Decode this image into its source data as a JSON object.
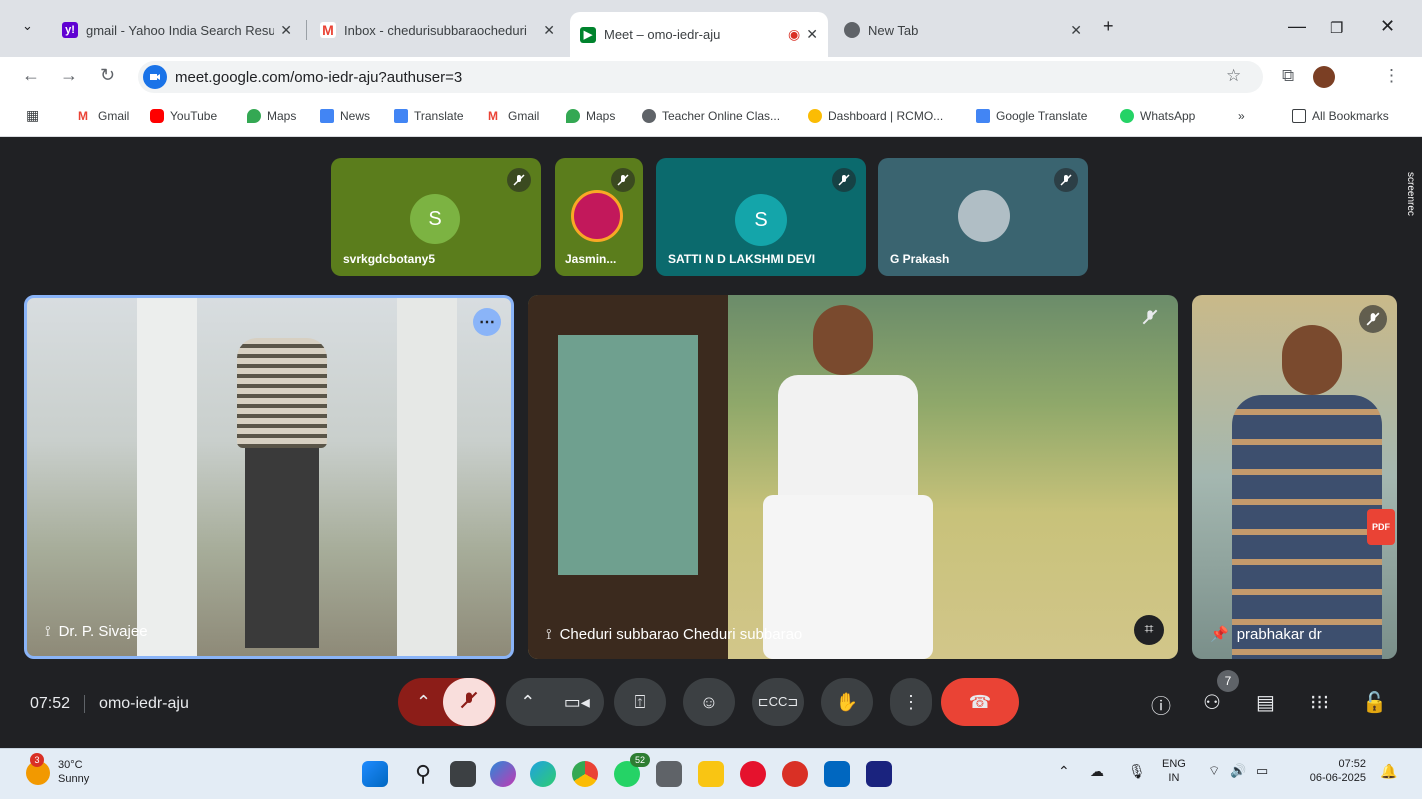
{
  "browser": {
    "tabs": [
      {
        "label": "gmail - Yahoo India Search Resu",
        "icon": "yahoo-icon"
      },
      {
        "label": "Inbox - chedurisubbaraocheduri",
        "icon": "gmail-icon"
      },
      {
        "label": "Meet – omo-iedr-aju",
        "icon": "meet-icon"
      },
      {
        "label": "New Tab",
        "icon": "chrome-icon"
      }
    ],
    "url": "meet.google.com/omo-iedr-aju?authuser=3",
    "bookmarks": [
      "Gmail",
      "YouTube",
      "Maps",
      "News",
      "Translate",
      "Gmail",
      "Maps",
      "Teacher Online Clas...",
      "Dashboard | RCMO...",
      "Google Translate",
      "WhatsApp"
    ],
    "all_bookmarks": "All Bookmarks",
    "more_bookmarks": "»"
  },
  "meet": {
    "top_tiles": [
      {
        "name": "svrkgdcbotany5",
        "initial": "S",
        "bg": "#5c7a1d",
        "avatar_bg": "#7cb342"
      },
      {
        "name": "Jasmin...",
        "initial": "",
        "bg": "#5c7a1d"
      },
      {
        "name": "SATTI N D LAKSHMI DEVI",
        "initial": "S",
        "bg": "#0b6b6e",
        "avatar_bg": "#12a4a8"
      },
      {
        "name": "G Prakash",
        "initial": "",
        "bg": "#3b6570"
      }
    ],
    "main_tiles": [
      {
        "name": "Dr. P. Sivajee"
      },
      {
        "name": "Cheduri subbarao Cheduri subbarao"
      },
      {
        "name": "prabhakar dr"
      }
    ],
    "time": "07:52",
    "meeting_code": "omo-iedr-aju",
    "participant_count": "7",
    "recording_watermark": "screenrec"
  },
  "taskbar": {
    "weather_temp": "30°C",
    "weather_desc": "Sunny",
    "weather_badge": "3",
    "whatsapp_badge": "52",
    "lang": "ENG",
    "region": "IN",
    "clock_time": "07:52",
    "clock_date": "06-06-2025"
  }
}
